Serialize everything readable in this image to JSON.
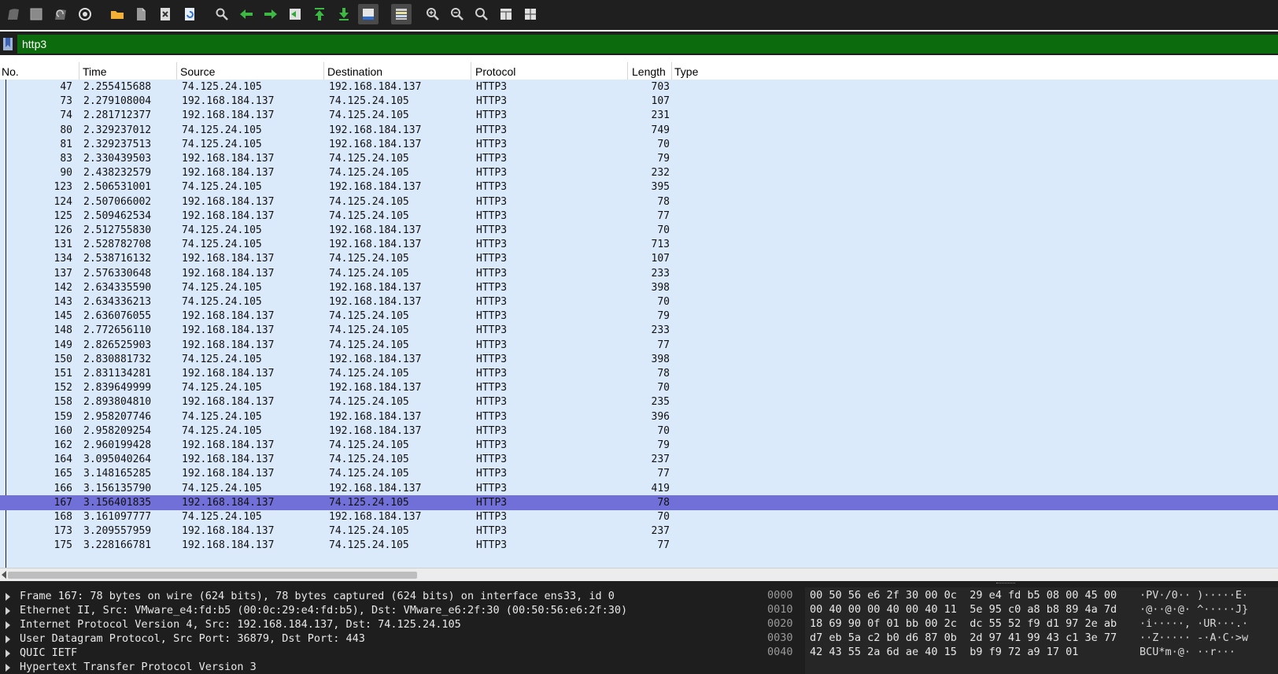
{
  "toolbar": {
    "icons": [
      "start-capture-icon",
      "stop-capture-icon",
      "restart-capture-icon",
      "capture-options-icon",
      "open-file-icon",
      "save-file-icon",
      "close-file-icon",
      "reload-file-icon",
      "find-packet-icon",
      "go-back-icon",
      "go-forward-icon",
      "go-to-packet-icon",
      "first-packet-icon",
      "last-packet-icon",
      "autoscroll-icon",
      "colorize-icon",
      "zoom-in-icon",
      "zoom-out-icon",
      "normal-size-icon",
      "resize-columns-icon",
      "expand-icon"
    ]
  },
  "filter": {
    "value": "http3"
  },
  "columns": {
    "no": "No.",
    "time": "Time",
    "source": "Source",
    "destination": "Destination",
    "protocol": "Protocol",
    "length": "Length",
    "type": "Type"
  },
  "packets": [
    {
      "no": "47",
      "time": "2.255415688",
      "src": "74.125.24.105",
      "dst": "192.168.184.137",
      "proto": "HTTP3",
      "len": "703"
    },
    {
      "no": "73",
      "time": "2.279108004",
      "src": "192.168.184.137",
      "dst": "74.125.24.105",
      "proto": "HTTP3",
      "len": "107"
    },
    {
      "no": "74",
      "time": "2.281712377",
      "src": "192.168.184.137",
      "dst": "74.125.24.105",
      "proto": "HTTP3",
      "len": "231"
    },
    {
      "no": "80",
      "time": "2.329237012",
      "src": "74.125.24.105",
      "dst": "192.168.184.137",
      "proto": "HTTP3",
      "len": "749"
    },
    {
      "no": "81",
      "time": "2.329237513",
      "src": "74.125.24.105",
      "dst": "192.168.184.137",
      "proto": "HTTP3",
      "len": "70"
    },
    {
      "no": "83",
      "time": "2.330439503",
      "src": "192.168.184.137",
      "dst": "74.125.24.105",
      "proto": "HTTP3",
      "len": "79"
    },
    {
      "no": "90",
      "time": "2.438232579",
      "src": "192.168.184.137",
      "dst": "74.125.24.105",
      "proto": "HTTP3",
      "len": "232"
    },
    {
      "no": "123",
      "time": "2.506531001",
      "src": "74.125.24.105",
      "dst": "192.168.184.137",
      "proto": "HTTP3",
      "len": "395"
    },
    {
      "no": "124",
      "time": "2.507066002",
      "src": "192.168.184.137",
      "dst": "74.125.24.105",
      "proto": "HTTP3",
      "len": "78"
    },
    {
      "no": "125",
      "time": "2.509462534",
      "src": "192.168.184.137",
      "dst": "74.125.24.105",
      "proto": "HTTP3",
      "len": "77"
    },
    {
      "no": "126",
      "time": "2.512755830",
      "src": "74.125.24.105",
      "dst": "192.168.184.137",
      "proto": "HTTP3",
      "len": "70"
    },
    {
      "no": "131",
      "time": "2.528782708",
      "src": "74.125.24.105",
      "dst": "192.168.184.137",
      "proto": "HTTP3",
      "len": "713"
    },
    {
      "no": "134",
      "time": "2.538716132",
      "src": "192.168.184.137",
      "dst": "74.125.24.105",
      "proto": "HTTP3",
      "len": "107"
    },
    {
      "no": "137",
      "time": "2.576330648",
      "src": "192.168.184.137",
      "dst": "74.125.24.105",
      "proto": "HTTP3",
      "len": "233"
    },
    {
      "no": "142",
      "time": "2.634335590",
      "src": "74.125.24.105",
      "dst": "192.168.184.137",
      "proto": "HTTP3",
      "len": "398"
    },
    {
      "no": "143",
      "time": "2.634336213",
      "src": "74.125.24.105",
      "dst": "192.168.184.137",
      "proto": "HTTP3",
      "len": "70"
    },
    {
      "no": "145",
      "time": "2.636076055",
      "src": "192.168.184.137",
      "dst": "74.125.24.105",
      "proto": "HTTP3",
      "len": "79"
    },
    {
      "no": "148",
      "time": "2.772656110",
      "src": "192.168.184.137",
      "dst": "74.125.24.105",
      "proto": "HTTP3",
      "len": "233"
    },
    {
      "no": "149",
      "time": "2.826525903",
      "src": "192.168.184.137",
      "dst": "74.125.24.105",
      "proto": "HTTP3",
      "len": "77"
    },
    {
      "no": "150",
      "time": "2.830881732",
      "src": "74.125.24.105",
      "dst": "192.168.184.137",
      "proto": "HTTP3",
      "len": "398"
    },
    {
      "no": "151",
      "time": "2.831134281",
      "src": "192.168.184.137",
      "dst": "74.125.24.105",
      "proto": "HTTP3",
      "len": "78"
    },
    {
      "no": "152",
      "time": "2.839649999",
      "src": "74.125.24.105",
      "dst": "192.168.184.137",
      "proto": "HTTP3",
      "len": "70"
    },
    {
      "no": "158",
      "time": "2.893804810",
      "src": "192.168.184.137",
      "dst": "74.125.24.105",
      "proto": "HTTP3",
      "len": "235"
    },
    {
      "no": "159",
      "time": "2.958207746",
      "src": "74.125.24.105",
      "dst": "192.168.184.137",
      "proto": "HTTP3",
      "len": "396"
    },
    {
      "no": "160",
      "time": "2.958209254",
      "src": "74.125.24.105",
      "dst": "192.168.184.137",
      "proto": "HTTP3",
      "len": "70"
    },
    {
      "no": "162",
      "time": "2.960199428",
      "src": "192.168.184.137",
      "dst": "74.125.24.105",
      "proto": "HTTP3",
      "len": "79"
    },
    {
      "no": "164",
      "time": "3.095040264",
      "src": "192.168.184.137",
      "dst": "74.125.24.105",
      "proto": "HTTP3",
      "len": "237"
    },
    {
      "no": "165",
      "time": "3.148165285",
      "src": "192.168.184.137",
      "dst": "74.125.24.105",
      "proto": "HTTP3",
      "len": "77"
    },
    {
      "no": "166",
      "time": "3.156135790",
      "src": "74.125.24.105",
      "dst": "192.168.184.137",
      "proto": "HTTP3",
      "len": "419"
    },
    {
      "no": "167",
      "time": "3.156401835",
      "src": "192.168.184.137",
      "dst": "74.125.24.105",
      "proto": "HTTP3",
      "len": "78",
      "selected": true
    },
    {
      "no": "168",
      "time": "3.161097777",
      "src": "74.125.24.105",
      "dst": "192.168.184.137",
      "proto": "HTTP3",
      "len": "70"
    },
    {
      "no": "173",
      "time": "3.209557959",
      "src": "192.168.184.137",
      "dst": "74.125.24.105",
      "proto": "HTTP3",
      "len": "237"
    },
    {
      "no": "175",
      "time": "3.228166781",
      "src": "192.168.184.137",
      "dst": "74.125.24.105",
      "proto": "HTTP3",
      "len": "77"
    }
  ],
  "details": [
    "Frame 167: 78 bytes on wire (624 bits), 78 bytes captured (624 bits) on interface ens33, id 0",
    "Ethernet II, Src: VMware_e4:fd:b5 (00:0c:29:e4:fd:b5), Dst: VMware_e6:2f:30 (00:50:56:e6:2f:30)",
    "Internet Protocol Version 4, Src: 192.168.184.137, Dst: 74.125.24.105",
    "User Datagram Protocol, Src Port: 36879, Dst Port: 443",
    "QUIC IETF",
    "Hypertext Transfer Protocol Version 3"
  ],
  "hex": [
    {
      "offset": "0000",
      "bytes": "00 50 56 e6 2f 30 00 0c  29 e4 fd b5 08 00 45 00",
      "ascii": "·PV·/0·· )·····E·"
    },
    {
      "offset": "0010",
      "bytes": "00 40 00 00 40 00 40 11  5e 95 c0 a8 b8 89 4a 7d",
      "ascii": "·@··@·@· ^·····J}"
    },
    {
      "offset": "0020",
      "bytes": "18 69 90 0f 01 bb 00 2c  dc 55 52 f9 d1 97 2e ab",
      "ascii": "·i·····, ·UR···.·"
    },
    {
      "offset": "0030",
      "bytes": "d7 eb 5a c2 b0 d6 87 0b  2d 97 41 99 43 c1 3e 77",
      "ascii": "··Z····· -·A·C·>w"
    },
    {
      "offset": "0040",
      "bytes": "42 43 55 2a 6d ae 40 15  b9 f9 72 a9 17 01",
      "ascii": "BCU*m·@· ··r···"
    }
  ],
  "colors": {
    "toolbar_bg": "#1f1f1f",
    "filter_bg": "#0c6b0c",
    "row_bg": "#dbeafb",
    "selected_bg": "#7070d8",
    "details_bg": "#1e1e1e"
  }
}
